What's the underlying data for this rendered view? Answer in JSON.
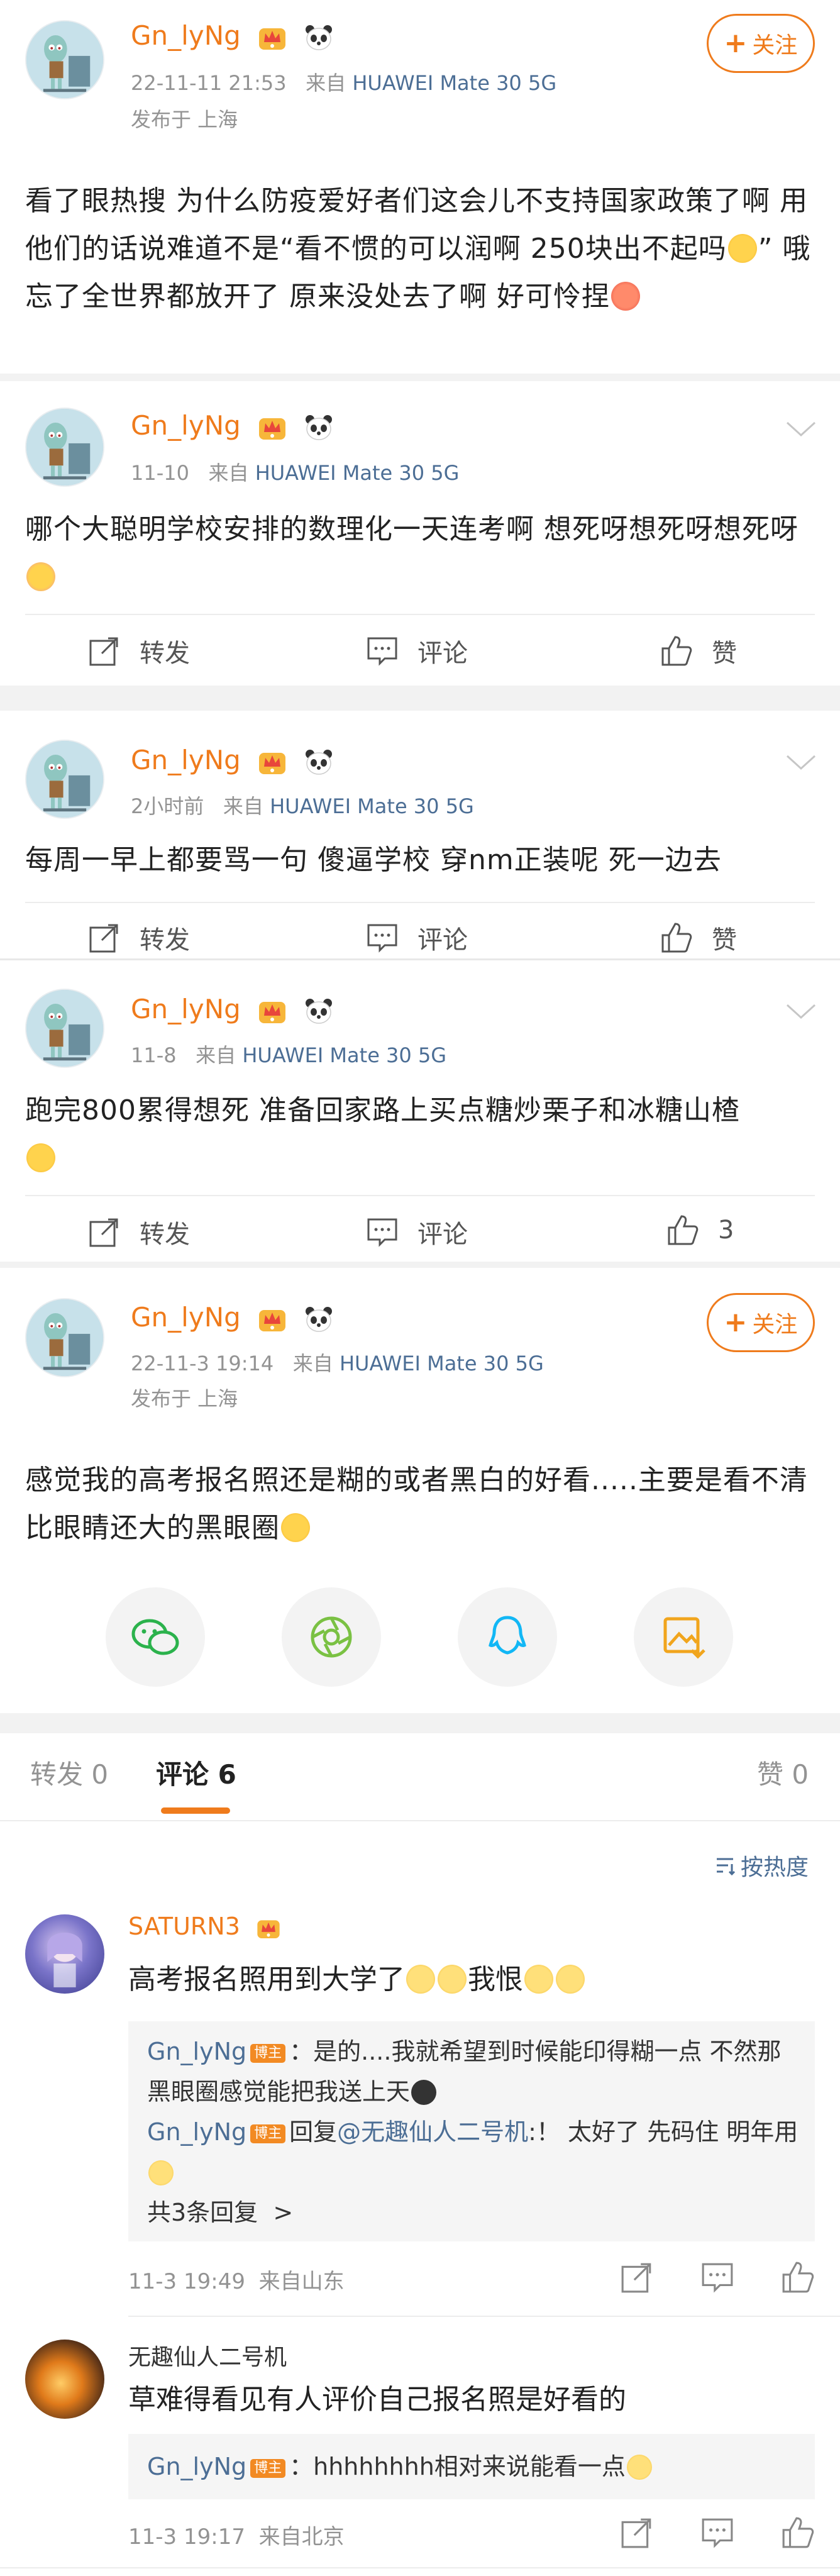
{
  "posts": [
    {
      "username": "Gn_lyNg",
      "time": "22-11-11 21:53",
      "source_prefix": "来自",
      "device": "HUAWEI Mate 30 5G",
      "location": "发布于 上海",
      "follow_label": "关注",
      "text": "看了眼热搜 为什么防疫爱好者们这会儿不支持国家政策了啊 用他们的话说难道不是“看不惯的可以润啊 250块出不起吗",
      "text_tail": "” 哦忘了全世界都放开了 原来没处去了啊 好可怜捏"
    },
    {
      "username": "Gn_lyNg",
      "time": "11-10",
      "source_prefix": "来自",
      "device": "HUAWEI Mate 30 5G",
      "text": "哪个大聪明学校安排的数理化一天连考啊 想死呀想死呀想死呀",
      "actions": {
        "repost": "转发",
        "comment": "评论",
        "like": "赞"
      }
    },
    {
      "username": "Gn_lyNg",
      "time": "2小时前",
      "source_prefix": "来自",
      "device": "HUAWEI Mate 30 5G",
      "text": "每周一早上都要骂一句 傻逼学校 穿nm正装呢 死一边去",
      "actions": {
        "repost": "转发",
        "comment": "评论",
        "like": "赞"
      }
    },
    {
      "username": "Gn_lyNg",
      "time": "11-8",
      "source_prefix": "来自",
      "device": "HUAWEI Mate 30 5G",
      "text": "跑完800累得想死 准备回家路上买点糖炒栗子和冰糖山楂",
      "actions": {
        "repost": "转发",
        "comment": "评论",
        "like": "3"
      }
    },
    {
      "username": "Gn_lyNg",
      "time": "22-11-3 19:14",
      "source_prefix": "来自",
      "device": "HUAWEI Mate 30 5G",
      "location": "发布于 上海",
      "follow_label": "关注",
      "text": "感觉我的高考报名照还是糊的或者黑白的好看.....主要是看不清比眼睛还大的黑眼圈"
    }
  ],
  "share_icons": [
    "wechat-icon",
    "moments-icon",
    "qq-icon",
    "save-image-icon"
  ],
  "tabs": {
    "repost": "转发 0",
    "comment": "评论 6",
    "like": "赞 0"
  },
  "sort_label": "按热度",
  "comments": [
    {
      "username": "SATURN3",
      "text": "高考报名照用到大学了",
      "text_tail": "我恨",
      "replies": [
        {
          "user": "Gn_lyNg",
          "tag": "博主",
          "text": "：是的....我就希望到时候能印得糊一点 不然那黑眼圈感觉能把我送上天"
        },
        {
          "user": "Gn_lyNg",
          "tag": "博主",
          "prefix": "回复",
          "mention": "@无趣仙人二号机",
          "text": ":！ 太好了 先码住 明年用"
        }
      ],
      "more_replies": "共3条回复",
      "time": "11-3 19:49",
      "from": "来自山东"
    },
    {
      "username": "无趣仙人二号机",
      "text": "草难得看见有人评价自己报名照是好看的",
      "replies": [
        {
          "user": "Gn_lyNg",
          "tag": "博主",
          "text": "：hhhhhhhh相对来说能看一点"
        }
      ],
      "time": "11-3 19:17",
      "from": "来自北京"
    }
  ]
}
